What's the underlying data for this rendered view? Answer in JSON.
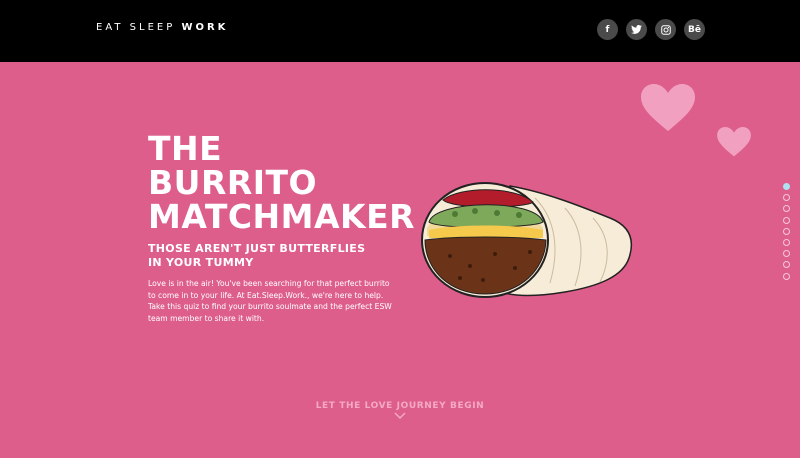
{
  "header": {
    "logo_light": "EAT SLEEP ",
    "logo_bold": "WORK",
    "social": [
      {
        "label": "f",
        "icon": "facebook-icon"
      },
      {
        "label": "t",
        "icon": "twitter-icon"
      },
      {
        "label": "◙",
        "icon": "instagram-icon"
      },
      {
        "label": "Bē",
        "icon": "behance-icon"
      }
    ]
  },
  "hero": {
    "title_lines": [
      "THE",
      "BURRITO",
      "MATCHMAKER"
    ],
    "subtitle_lines": [
      "THOSE AREN'T JUST BUTTERFLIES",
      "IN YOUR TUMMY"
    ],
    "body": "Love is in the air! You've been searching for that perfect burrito to come in to your life. At Eat.Sleep.Work., we're here to help. Take this quiz to find your burrito soulmate and the perfect ESW team member to share it with.",
    "cta": "LET THE LOVE JOURNEY BEGIN"
  },
  "pagination": {
    "total": 9,
    "active_index": 0
  },
  "colors": {
    "background": "#de5e8b",
    "topbar": "#000000",
    "heart": "#f3a9c4",
    "active_dot": "#aee0f2"
  }
}
